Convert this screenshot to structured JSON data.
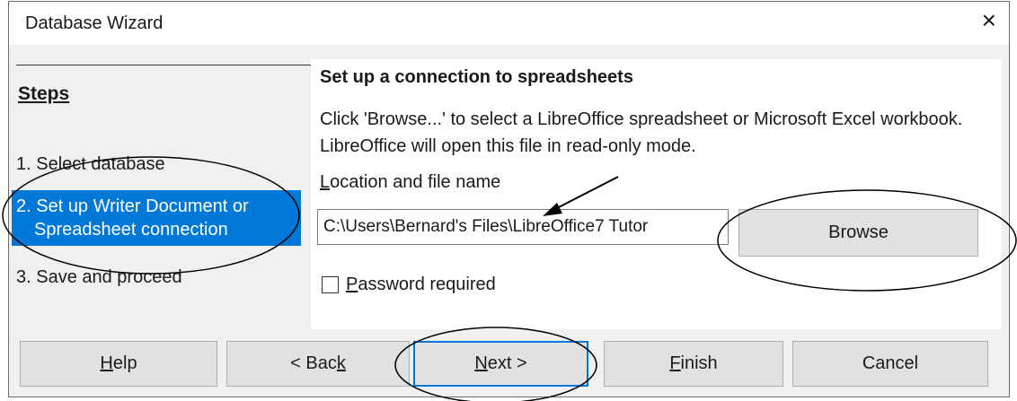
{
  "window": {
    "title": "Database Wizard",
    "close_glyph": "×"
  },
  "steps": {
    "title": "Steps",
    "items": [
      {
        "label": "1. Select database"
      },
      {
        "label_line1": "2. Set up Writer Document or",
        "label_line2": "Spreadsheet connection"
      },
      {
        "label": "3. Save and proceed"
      }
    ]
  },
  "content": {
    "heading": "Set up a connection to spreadsheets",
    "description": "Click 'Browse...' to select a LibreOffice spreadsheet or Microsoft Excel workbook. LibreOffice will open this file in read-only mode.",
    "location_label_accel": "L",
    "location_label_rest": "ocation and file name",
    "location_value": "C:\\Users\\Bernard's Files\\LibreOffice7 Tutor",
    "browse_label": "Browse",
    "password_accel": "P",
    "password_rest": "assword required",
    "password_checked": false
  },
  "buttons": {
    "help_accel": "H",
    "help_rest": "elp",
    "back_prefix": "< Bac",
    "back_accel": "k",
    "next_accel": "N",
    "next_rest": "ext >",
    "finish_accel": "F",
    "finish_rest": "inish",
    "cancel": "Cancel"
  },
  "colors": {
    "selection": "#0078d7",
    "dialog_bg": "#f0f0f0",
    "button_bg": "#e1e1e1"
  }
}
